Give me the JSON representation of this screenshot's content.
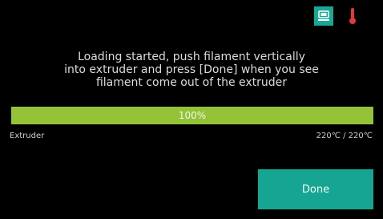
{
  "status_icons": [
    {
      "icon": "screen-icon",
      "color": "#1aa795"
    },
    {
      "icon": "thermometer-icon",
      "color": "#e23a3a"
    }
  ],
  "message": {
    "line1": "Loading started, push filament vertically",
    "line2": "into extruder and press [Done] when you see",
    "line3": "filament come out of the extruder"
  },
  "progress": {
    "percent": 100,
    "label": "100%",
    "fill_color": "#94c338"
  },
  "extruder": {
    "label": "Extruder",
    "temperature": "220℃  /  220℃"
  },
  "done_button": {
    "label": "Done",
    "color": "#16a592"
  }
}
